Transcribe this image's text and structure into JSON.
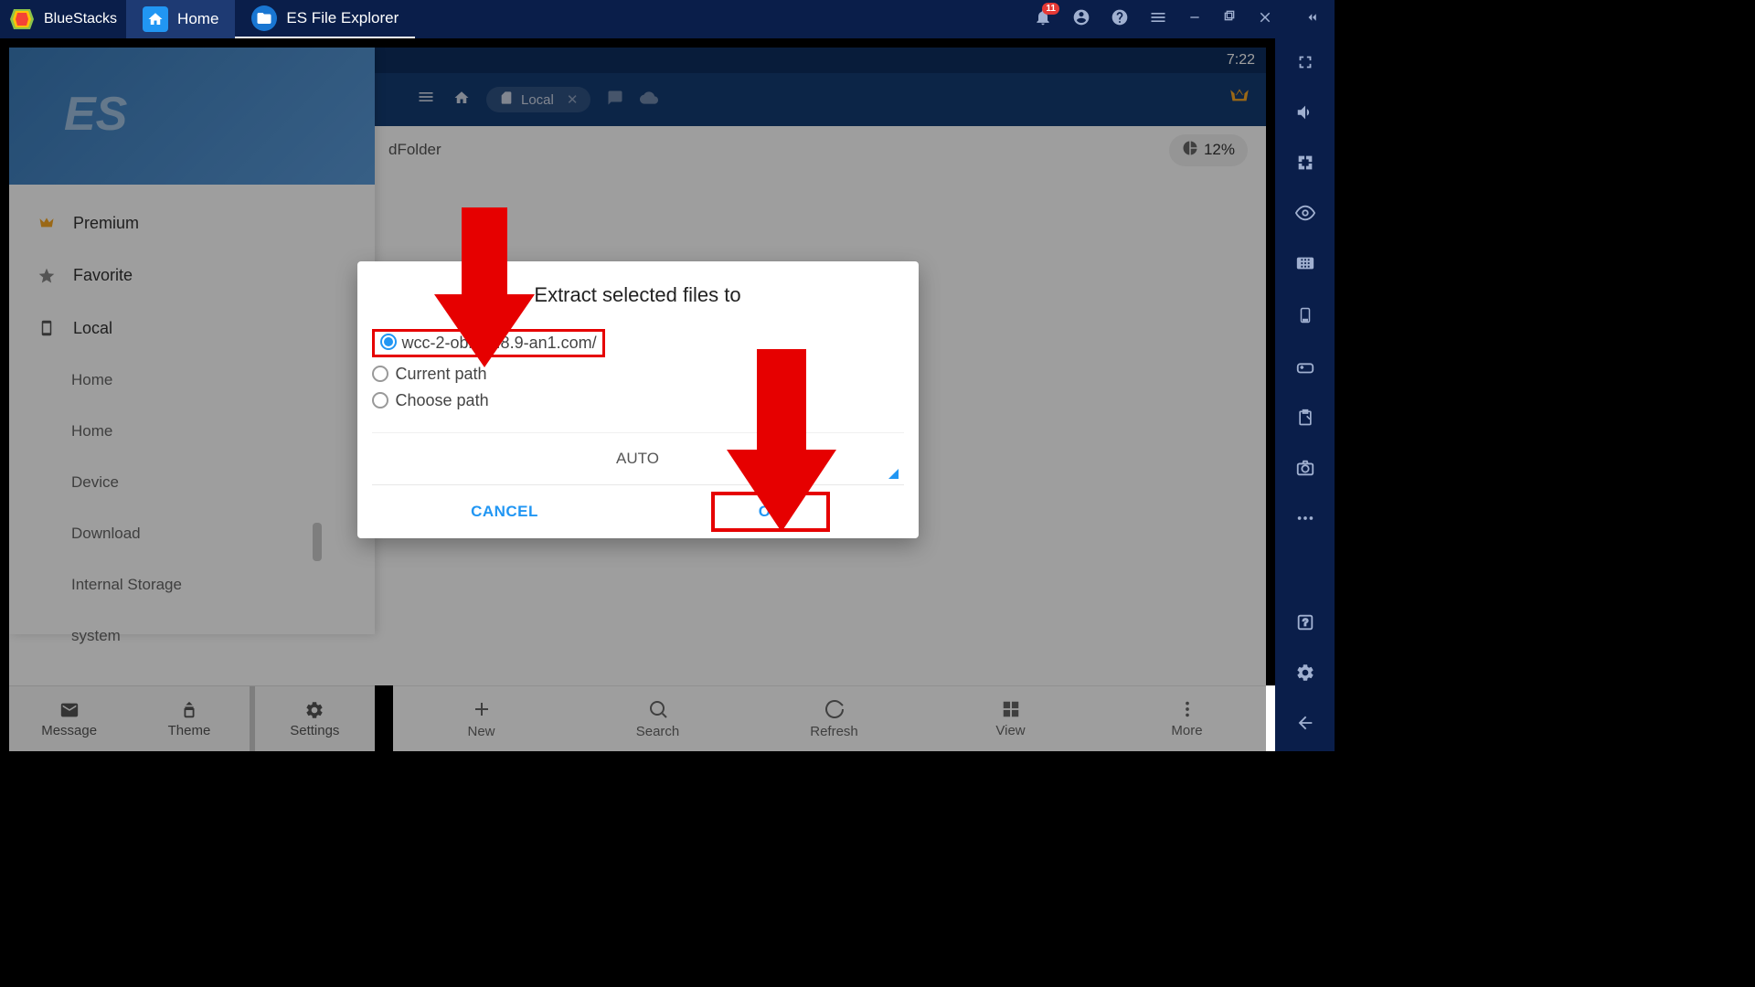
{
  "titlebar": {
    "app_name": "BlueStacks",
    "notification_count": "11",
    "tabs": [
      {
        "label": "Home"
      },
      {
        "label": "ES File Explorer"
      }
    ]
  },
  "android_status": {
    "time": "7:22"
  },
  "es_header": {
    "breadcrumb_label": "Local"
  },
  "path_bar": {
    "folder_suffix": "dFolder",
    "storage_percent": "12%"
  },
  "sidebar": {
    "items": [
      {
        "label": "Premium"
      },
      {
        "label": "Favorite"
      },
      {
        "label": "Local"
      },
      {
        "label": "Home"
      },
      {
        "label": "Home"
      },
      {
        "label": "Device"
      },
      {
        "label": "Download"
      },
      {
        "label": "Internal Storage"
      },
      {
        "label": "system"
      }
    ]
  },
  "left_tabs": {
    "message": "Message",
    "theme": "Theme",
    "settings": "Settings"
  },
  "bottom_bar": {
    "new": "New",
    "search": "Search",
    "refresh": "Refresh",
    "view": "View",
    "more": "More"
  },
  "dialog": {
    "title": "Extract selected files to",
    "option1": "wcc-2-obb_2.8.9-an1.com/",
    "option2": "Current path",
    "option3": "Choose path",
    "encoding": "AUTO",
    "cancel": "CANCEL",
    "ok": "OK"
  }
}
